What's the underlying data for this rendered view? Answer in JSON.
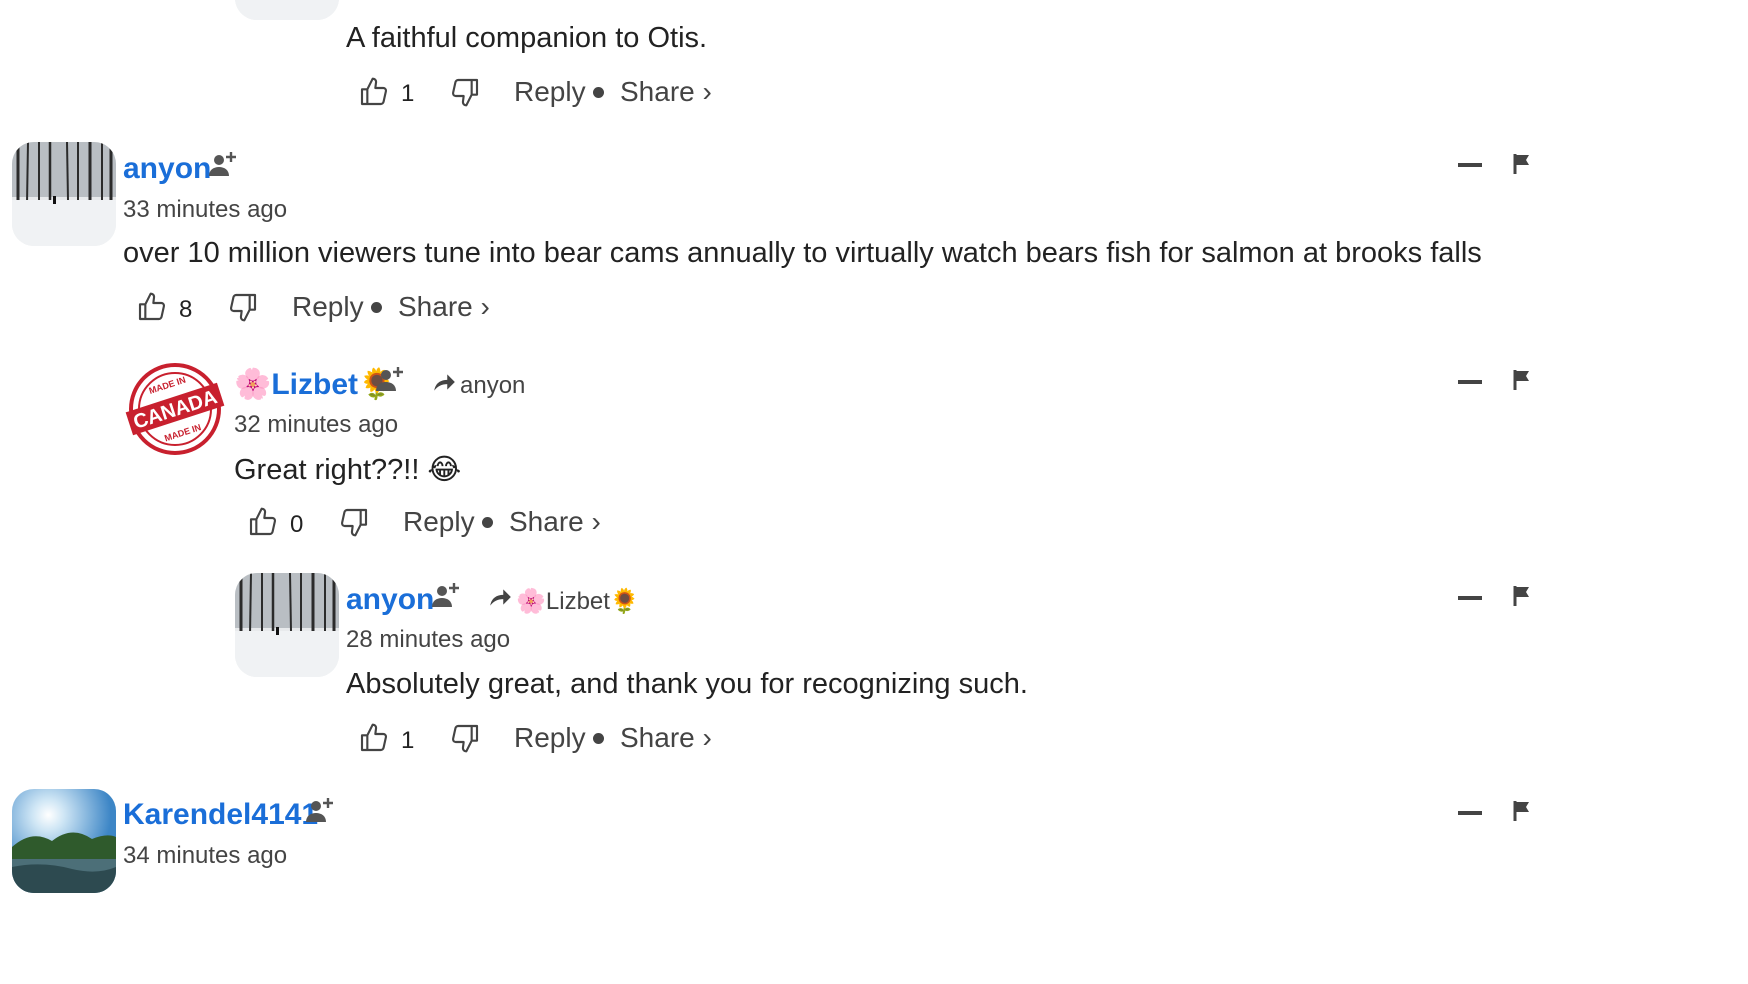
{
  "comments": [
    {
      "text": "A faithful companion to Otis.",
      "likes": "1",
      "reply_label": "Reply",
      "share_label": "Share ›"
    },
    {
      "username": "anyon",
      "time": "33 minutes ago",
      "text": "over 10 million viewers tune into bear cams annually to virtually watch bears fish for salmon at brooks falls",
      "likes": "8",
      "reply_label": "Reply",
      "share_label": "Share ›"
    },
    {
      "username": "🌸Lizbet🌻",
      "reply_to": "anyon",
      "avatar_text_top": "MADE IN",
      "avatar_text_main": "CANADA",
      "avatar_text_bottom": "MADE IN",
      "time": "32 minutes ago",
      "text": "Great right??!! 😂",
      "likes": "0",
      "reply_label": "Reply",
      "share_label": "Share ›"
    },
    {
      "username": "anyon",
      "reply_to": "🌸Lizbet🌻",
      "time": "28 minutes ago",
      "text": "Absolutely great, and thank you for recognizing such.",
      "likes": "1",
      "reply_label": "Reply",
      "share_label": "Share ›"
    },
    {
      "username": "Karendel4141",
      "time": "34 minutes ago"
    }
  ],
  "icons": {
    "like": "thumbs-up-icon",
    "dislike": "thumbs-down-icon",
    "follow": "follow-user-icon",
    "reply_arrow": "reply-arrow-icon",
    "collapse": "collapse-icon",
    "flag": "flag-icon"
  },
  "colors": {
    "username": "#1a6ed8",
    "text": "#222222",
    "muted": "#444444",
    "stamp": "#c8202e"
  }
}
